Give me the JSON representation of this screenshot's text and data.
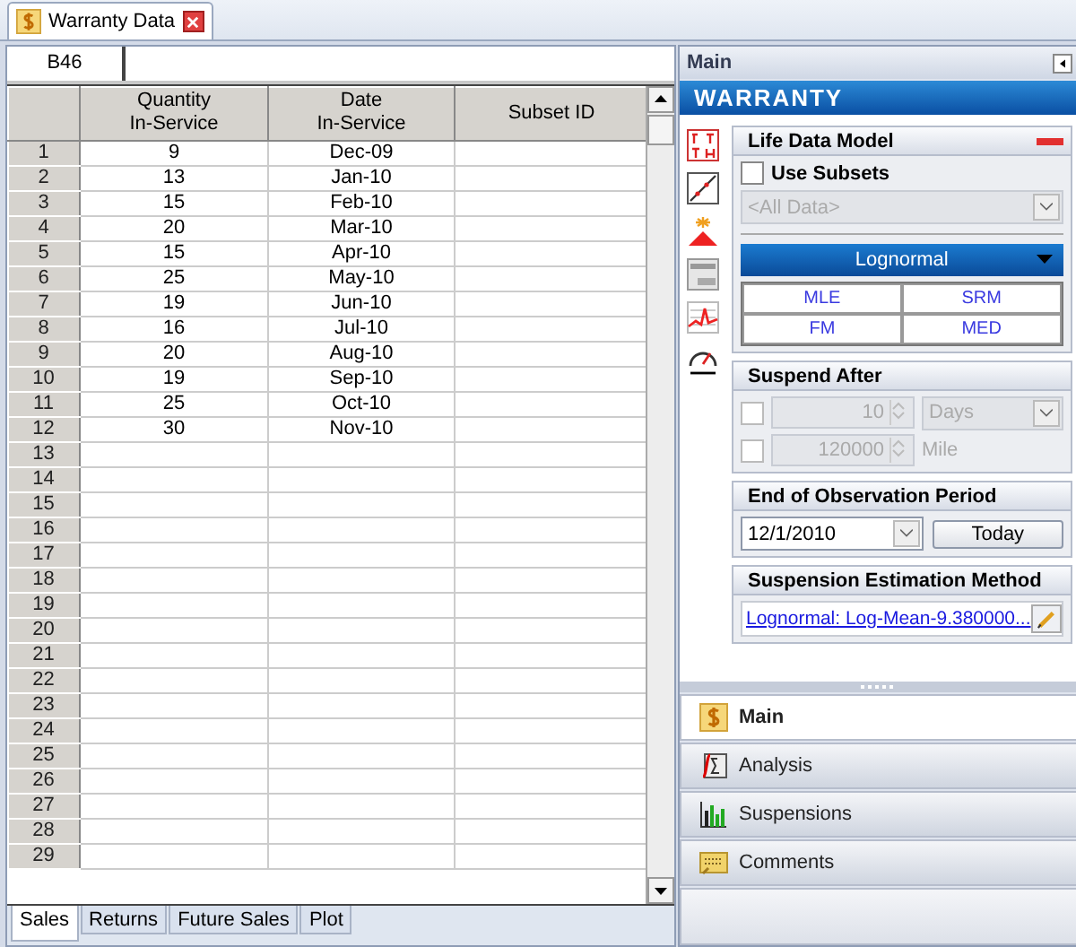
{
  "document_tab": {
    "title": "Warranty Data"
  },
  "cell_reference": "B46",
  "table": {
    "columns": [
      "Quantity\nIn-Service",
      "Date\nIn-Service",
      "Subset ID"
    ],
    "rows": [
      {
        "label": "1",
        "cells": [
          "9",
          "Dec-09",
          ""
        ]
      },
      {
        "label": "2",
        "cells": [
          "13",
          "Jan-10",
          ""
        ]
      },
      {
        "label": "3",
        "cells": [
          "15",
          "Feb-10",
          ""
        ]
      },
      {
        "label": "4",
        "cells": [
          "20",
          "Mar-10",
          ""
        ]
      },
      {
        "label": "5",
        "cells": [
          "15",
          "Apr-10",
          ""
        ]
      },
      {
        "label": "6",
        "cells": [
          "25",
          "May-10",
          ""
        ]
      },
      {
        "label": "7",
        "cells": [
          "19",
          "Jun-10",
          ""
        ]
      },
      {
        "label": "8",
        "cells": [
          "16",
          "Jul-10",
          ""
        ]
      },
      {
        "label": "9",
        "cells": [
          "20",
          "Aug-10",
          ""
        ]
      },
      {
        "label": "10",
        "cells": [
          "19",
          "Sep-10",
          ""
        ]
      },
      {
        "label": "11",
        "cells": [
          "25",
          "Oct-10",
          ""
        ]
      },
      {
        "label": "12",
        "cells": [
          "30",
          "Nov-10",
          ""
        ]
      },
      {
        "label": "13",
        "cells": [
          "",
          "",
          ""
        ]
      },
      {
        "label": "14",
        "cells": [
          "",
          "",
          ""
        ]
      },
      {
        "label": "15",
        "cells": [
          "",
          "",
          ""
        ]
      },
      {
        "label": "16",
        "cells": [
          "",
          "",
          ""
        ]
      },
      {
        "label": "17",
        "cells": [
          "",
          "",
          ""
        ]
      },
      {
        "label": "18",
        "cells": [
          "",
          "",
          ""
        ]
      },
      {
        "label": "19",
        "cells": [
          "",
          "",
          ""
        ]
      },
      {
        "label": "20",
        "cells": [
          "",
          "",
          ""
        ]
      },
      {
        "label": "21",
        "cells": [
          "",
          "",
          ""
        ]
      },
      {
        "label": "22",
        "cells": [
          "",
          "",
          ""
        ]
      },
      {
        "label": "23",
        "cells": [
          "",
          "",
          ""
        ]
      },
      {
        "label": "24",
        "cells": [
          "",
          "",
          ""
        ]
      },
      {
        "label": "25",
        "cells": [
          "",
          "",
          ""
        ]
      },
      {
        "label": "26",
        "cells": [
          "",
          "",
          ""
        ]
      },
      {
        "label": "27",
        "cells": [
          "",
          "",
          ""
        ]
      },
      {
        "label": "28",
        "cells": [
          "",
          "",
          ""
        ]
      },
      {
        "label": "29",
        "cells": [
          "",
          "",
          ""
        ]
      }
    ]
  },
  "sheet_tabs": [
    {
      "label": "Sales",
      "selected": true
    },
    {
      "label": "Returns",
      "selected": false
    },
    {
      "label": "Future Sales",
      "selected": false
    },
    {
      "label": "Plot",
      "selected": false
    }
  ],
  "panel": {
    "title": "Main",
    "banner": "WARRANTY",
    "life_data_model": {
      "title": "Life Data Model",
      "use_subsets": {
        "label": "Use Subsets",
        "checked": false
      },
      "subset_select": {
        "value": "<All Data>",
        "disabled": true
      },
      "distribution": "Lognormal",
      "methods": [
        "MLE",
        "SRM",
        "FM",
        "MED"
      ]
    },
    "suspend_after": {
      "title": "Suspend After",
      "rows": [
        {
          "checked": false,
          "value": "10",
          "unit": "Days",
          "kind": "select"
        },
        {
          "checked": false,
          "value": "120000",
          "unit": "Mile",
          "kind": "label"
        }
      ]
    },
    "end_of_observation": {
      "title": "End of Observation Period",
      "date": "12/1/2010",
      "button": "Today"
    },
    "suspension_estimation": {
      "title": "Suspension Estimation Method",
      "link": "Lognormal: Log-Mean-9.380000..."
    },
    "nav": [
      {
        "label": "Main",
        "selected": true
      },
      {
        "label": "Analysis",
        "selected": false
      },
      {
        "label": "Suspensions",
        "selected": false
      },
      {
        "label": "Comments",
        "selected": false
      }
    ]
  }
}
